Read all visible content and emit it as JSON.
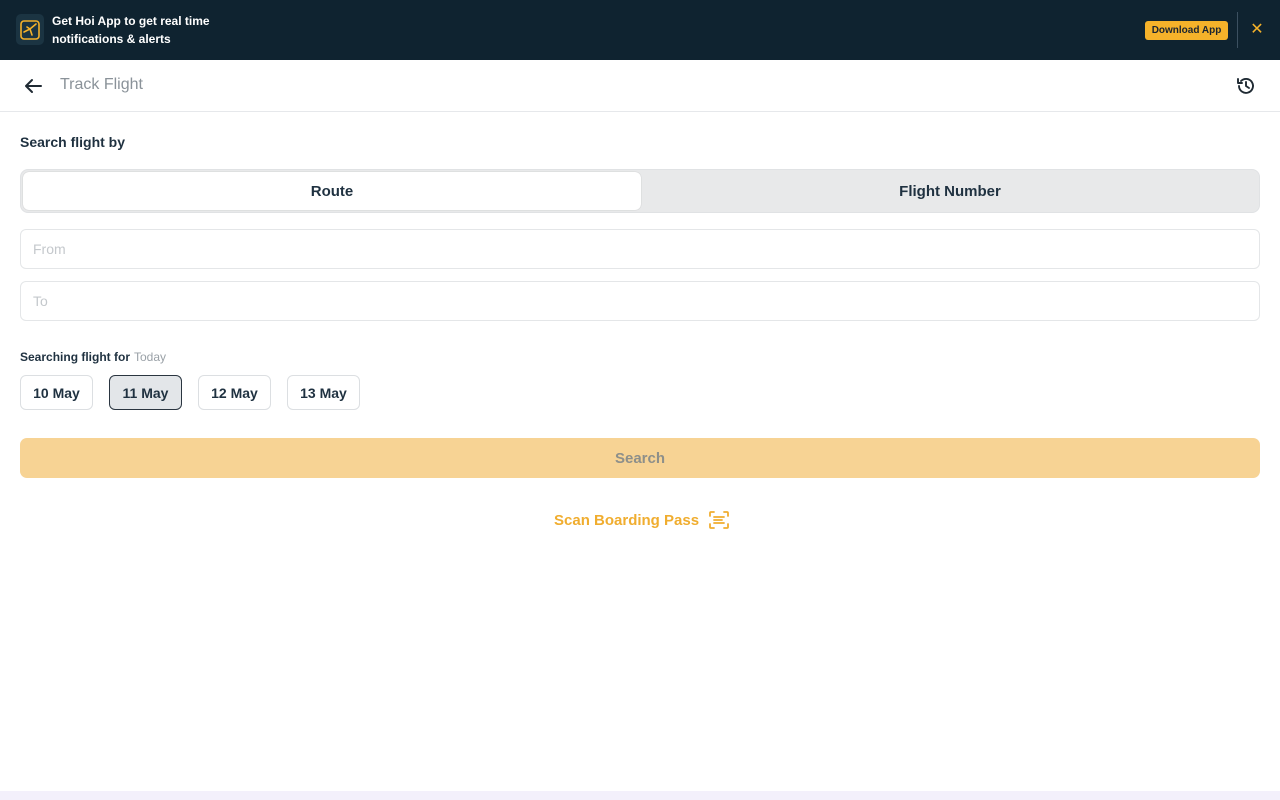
{
  "banner": {
    "logo_icon": "hoi-app-logo-icon",
    "message": "Get Hoi App to get real time notifications & alerts",
    "download_label": "Download App",
    "close_icon": "close-icon"
  },
  "header": {
    "back_icon": "arrow-left-icon",
    "title": "Track Flight",
    "history_icon": "history-clock-icon"
  },
  "search": {
    "section_label": "Search flight  by",
    "tabs": [
      {
        "label": "Route",
        "selected": true
      },
      {
        "label": "Flight Number",
        "selected": false
      }
    ],
    "from_placeholder": "From",
    "to_placeholder": "To"
  },
  "dates": {
    "label": "Searching flight for",
    "selected_text": "Today",
    "options": [
      {
        "label": "10 May",
        "selected": false
      },
      {
        "label": "11 May",
        "selected": true
      },
      {
        "label": "12 May",
        "selected": false
      },
      {
        "label": "13 May",
        "selected": false
      }
    ]
  },
  "actions": {
    "search_label": "Search",
    "scan_label": "Scan Boarding Pass",
    "scan_icon": "scan-document-icon"
  },
  "colors": {
    "banner_bg": "#0f2330",
    "accent": "#f5b22a",
    "search_disabled_bg": "#f7d394",
    "scan_text": "#f0ad2f"
  }
}
